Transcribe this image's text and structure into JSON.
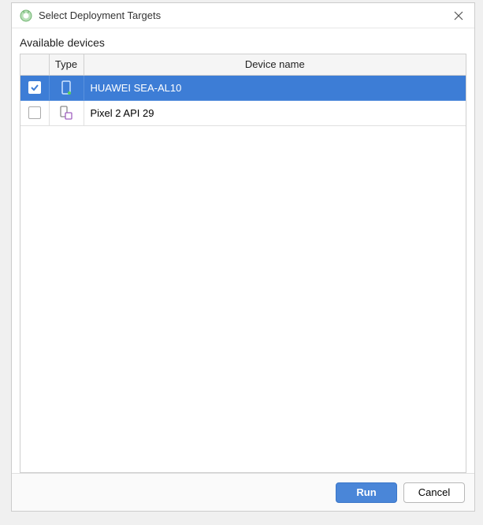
{
  "window": {
    "title": "Select Deployment Targets"
  },
  "section": {
    "available_label": "Available devices"
  },
  "table": {
    "headers": {
      "check": "",
      "type": "Type",
      "name": "Device name"
    },
    "rows": [
      {
        "selected": true,
        "device_kind": "physical",
        "name": "HUAWEI SEA-AL10"
      },
      {
        "selected": false,
        "device_kind": "virtual",
        "name": "Pixel 2 API 29"
      }
    ]
  },
  "buttons": {
    "run": "Run",
    "cancel": "Cancel"
  }
}
